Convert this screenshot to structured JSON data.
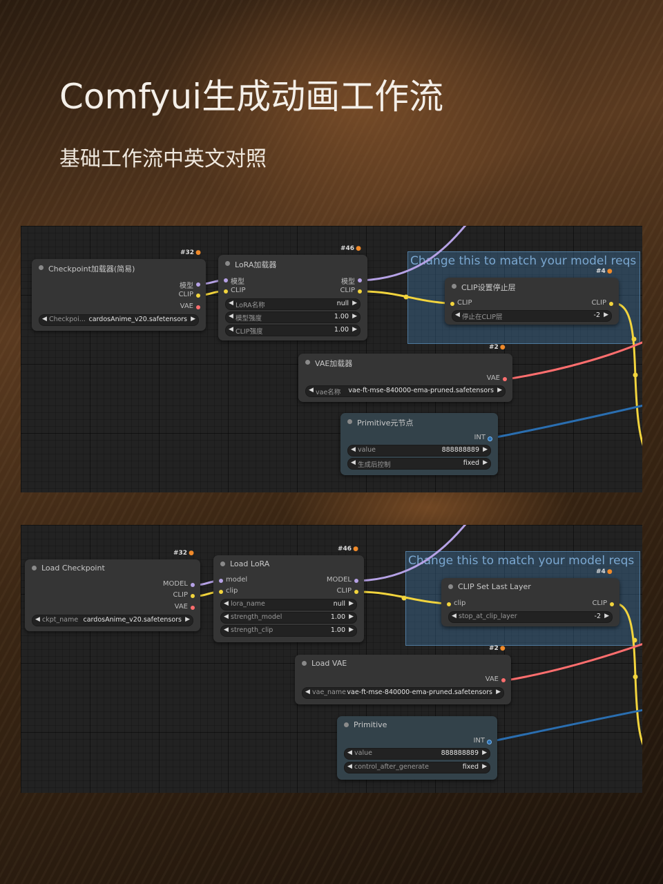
{
  "header": {
    "title": "Comfyui生成动画工作流",
    "subtitle": "基础工作流中英文对照"
  },
  "badge_icon": "fox-icon",
  "colors": {
    "model": "#b6a2e6",
    "clip": "#f2d43d",
    "vae": "#ff6e6e",
    "int": "#2a6eb0",
    "group": "#4682b4"
  },
  "cn": {
    "group_title": "Change this to match your model reqs",
    "checkpoint": {
      "badge": "#32",
      "title": "Checkpoint加载器(简易)",
      "out_model": "模型",
      "out_clip": "CLIP",
      "out_vae": "VAE",
      "w_name": "Checkpoi...",
      "w_value": "cardosAnime_v20.safetensors"
    },
    "lora": {
      "badge": "#46",
      "title": "LoRA加载器",
      "in_model": "模型",
      "in_clip": "CLIP",
      "out_model": "模型",
      "out_clip": "CLIP",
      "w1_name": "LoRA名称",
      "w1_value": "null",
      "w2_name": "模型强度",
      "w2_value": "1.00",
      "w3_name": "CLIP强度",
      "w3_value": "1.00"
    },
    "clipset": {
      "badge": "#4",
      "title": "CLIP设置停止层",
      "in_clip": "CLIP",
      "out_clip": "CLIP",
      "w_name": "停止在CLIP层",
      "w_value": "-2"
    },
    "vae": {
      "badge": "#2",
      "title": "VAE加载器",
      "out_vae": "VAE",
      "w_name": "vae名称",
      "w_value": "vae-ft-mse-840000-ema-pruned.safetensors"
    },
    "primitive": {
      "title": "Primitive元节点",
      "out_int": "INT",
      "w1_name": "value",
      "w1_value": "888888889",
      "w2_name": "生成后控制",
      "w2_value": "fixed"
    }
  },
  "en": {
    "group_title": "Change this to match your model reqs",
    "checkpoint": {
      "badge": "#32",
      "title": "Load Checkpoint",
      "out_model": "MODEL",
      "out_clip": "CLIP",
      "out_vae": "VAE",
      "w_name": "ckpt_name",
      "w_value": "cardosAnime_v20.safetensors"
    },
    "lora": {
      "badge": "#46",
      "title": "Load LoRA",
      "in_model": "model",
      "in_clip": "clip",
      "out_model": "MODEL",
      "out_clip": "CLIP",
      "w1_name": "lora_name",
      "w1_value": "null",
      "w2_name": "strength_model",
      "w2_value": "1.00",
      "w3_name": "strength_clip",
      "w3_value": "1.00"
    },
    "clipset": {
      "badge": "#4",
      "title": "CLIP Set Last Layer",
      "in_clip": "clip",
      "out_clip": "CLIP",
      "w_name": "stop_at_clip_layer",
      "w_value": "-2"
    },
    "vae": {
      "badge": "#2",
      "title": "Load VAE",
      "out_vae": "VAE",
      "w_name": "vae_name",
      "w_value": "vae-ft-mse-840000-ema-pruned.safetensors"
    },
    "primitive": {
      "title": "Primitive",
      "out_int": "INT",
      "w1_name": "value",
      "w1_value": "888888889",
      "w2_name": "control_after_generate",
      "w2_value": "fixed"
    }
  }
}
